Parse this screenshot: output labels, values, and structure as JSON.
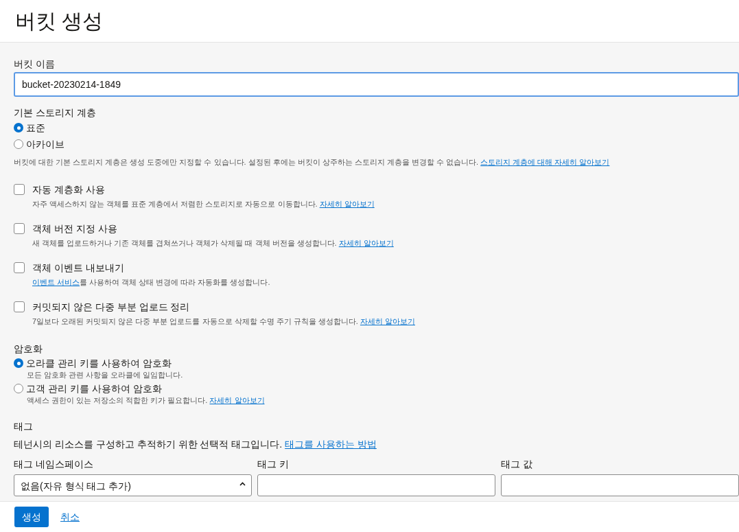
{
  "title": "버킷 생성",
  "bucket_name": {
    "label": "버킷 이름",
    "value": "bucket-20230214-1849"
  },
  "storage_tier": {
    "label": "기본 스토리지 계층",
    "options": [
      {
        "label": "표준",
        "selected": true
      },
      {
        "label": "아카이브",
        "selected": false
      }
    ],
    "help": [
      {
        "kind": "text",
        "text": "버킷에 대한 기본 스토리지 계층은 생성 도중에만 지정할 수 있습니다. 설정된 후에는 버킷이 상주하는 스토리지 계층을 변경할 수 없습니다. "
      },
      {
        "kind": "link",
        "text": "스토리지 계층에 대해 자세히 알아보기"
      }
    ]
  },
  "options": [
    {
      "label": "자동 계층화 사용",
      "checked": false,
      "description": [
        {
          "kind": "text",
          "text": "자주 액세스하지 않는 객체를 표준 계층에서 저렴한 스토리지로 자동으로 이동합니다. "
        },
        {
          "kind": "link",
          "text": "자세히 알아보기"
        }
      ]
    },
    {
      "label": "객체 버전 지정 사용",
      "checked": false,
      "description": [
        {
          "kind": "text",
          "text": "새 객체를 업로드하거나 기존 객체를 겹쳐쓰거나 객체가 삭제될 때 객체 버전을 생성합니다. "
        },
        {
          "kind": "link",
          "text": "자세히 알아보기"
        }
      ]
    },
    {
      "label": "객체 이벤트 내보내기",
      "checked": false,
      "description": [
        {
          "kind": "link",
          "text": "이벤트 서비스"
        },
        {
          "kind": "text",
          "text": "를 사용하여 객체 상태 변경에 따라 자동화를 생성합니다."
        }
      ]
    },
    {
      "label": "커밋되지 않은 다중 부분 업로드 정리",
      "checked": false,
      "description": [
        {
          "kind": "text",
          "text": "7일보다 오래된 커밋되지 않은 다중 부분 업로드를 자동으로 삭제할 수명 주기 규칙을 생성합니다. "
        },
        {
          "kind": "link",
          "text": "자세히 알아보기"
        }
      ]
    }
  ],
  "encryption": {
    "label": "암호화",
    "options": [
      {
        "label": "오라클 관리 키를 사용하여 암호화",
        "selected": true,
        "description": [
          {
            "kind": "text",
            "text": "모든 암호화 관련 사항을 오라클에 일임합니다."
          }
        ]
      },
      {
        "label": "고객 관리 키를 사용하여 암호화",
        "selected": false,
        "description": [
          {
            "kind": "text",
            "text": "액세스 권한이 있는 저장소의 적합한 키가 필요합니다. "
          },
          {
            "kind": "link",
            "text": "자세히 알아보기"
          }
        ]
      }
    ]
  },
  "tags": {
    "label": "태그",
    "description": [
      {
        "kind": "text",
        "text": "테넌시의 리소스를 구성하고 추적하기 위한 선택적 태그입니다. "
      },
      {
        "kind": "link",
        "text": "태그를 사용하는 방법"
      }
    ],
    "columns": [
      {
        "label": "태그 네임스페이스",
        "kind": "select",
        "value": "없음(자유 형식 태그 추가)"
      },
      {
        "label": "태그 키",
        "kind": "input"
      },
      {
        "label": "태그 값",
        "kind": "input"
      }
    ]
  },
  "footer": {
    "primary": "생성",
    "cancel": "취소"
  }
}
